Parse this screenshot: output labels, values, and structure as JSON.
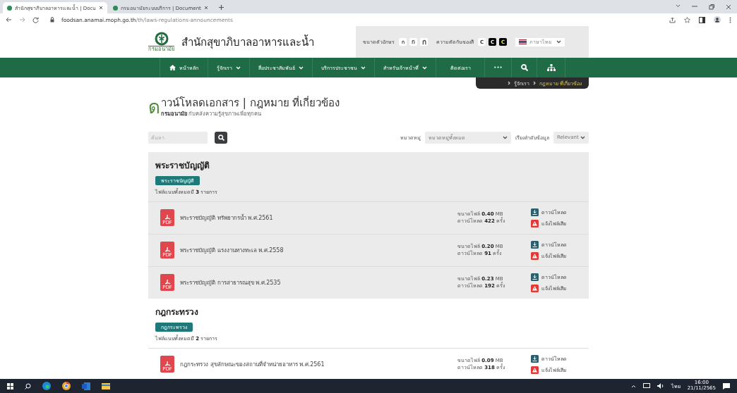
{
  "browser": {
    "tabs": [
      {
        "title": "สำนักสุขาภิบาลอาหารและน้ำ | Docu",
        "selected": true
      },
      {
        "title": "กรมอนามัยระบบบริการ | Document",
        "selected": false
      }
    ],
    "url_host": "foodsan.anamai.moph.go.th",
    "url_path": "/th/laws-regulations-announcements"
  },
  "header": {
    "site_name": "สำนักสุขาภิบาลอาหารและน้ำ",
    "logo_caption": "กรมอนามัย",
    "font_size_label": "ขนาดตัวอักษร",
    "font_sizes": [
      {
        "label": "ก",
        "kind": "small"
      },
      {
        "label": "ก",
        "kind": "medium"
      },
      {
        "label": "ก",
        "kind": "large"
      }
    ],
    "contrast_label": "ความตัดกันของสี",
    "contrast_options": [
      {
        "label": "C",
        "kind": "normal"
      },
      {
        "label": "C",
        "kind": "black"
      },
      {
        "label": "C",
        "kind": "yellow"
      }
    ],
    "language": "ภาษาไทย"
  },
  "nav": {
    "items": [
      {
        "label": "หน้าหลัก",
        "kind": "home"
      },
      {
        "label": "รู้จักเรา",
        "kind": "dropdown"
      },
      {
        "label": "สื่อประชาสัมพันธ์",
        "kind": "dropdown"
      },
      {
        "label": "บริการประชาชน",
        "kind": "dropdown"
      },
      {
        "label": "สำหรับเจ้าหน้าที่",
        "kind": "dropdown"
      },
      {
        "label": "ติดต่อเรา",
        "kind": "plain"
      },
      {
        "label": "•••",
        "kind": "plain"
      },
      {
        "kind": "search"
      },
      {
        "kind": "sitemap"
      }
    ]
  },
  "breadcrumb": [
    {
      "label": "รู้จักเรา",
      "current": false
    },
    {
      "label": "กฎหมาย ที่เกี่ยวข้อง",
      "current": true
    }
  ],
  "page": {
    "logo_letter": "ด",
    "title": "าวน์โหลดเอกสาร | กฎหมาย ที่เกี่ยวข้อง",
    "subtitle": "**กรมอนามัย** กับคลังความรู้สุขภาพเพื่อทุกคน"
  },
  "filters": {
    "search_placeholder": "ค้นหา",
    "category_label": "หมวดหมู่",
    "category_value": "หมวดหมู่ทั้งหมด",
    "sort_label": "เรียงลำดับข้อมูล",
    "sort_value": "Relevant"
  },
  "sections": [
    {
      "title": "พระราชบัญญัติ",
      "tag": "พระราชบัญญัติ",
      "count": "ไฟล์แนบทั้งหมดมี **3** รายการ",
      "highlighted": true,
      "files": [
        {
          "name": "พระราชบัญญัติ ทรัพยากรน้ำ พ.ศ.2561",
          "icon_text": "PDF",
          "size": "ขนาดไฟล์ **0.40** MB",
          "downloads": "ดาวน์โหลด **422** ครั้ง",
          "download_label": "ดาวน์โหลด",
          "report_label": "แจ้งไฟล์เสีย"
        },
        {
          "name": "พระราชบัญญัติ แรงงานทางทะเล พ.ศ.2558",
          "icon_text": "PDF",
          "size": "ขนาดไฟล์ **0.20** MB",
          "downloads": "ดาวน์โหลด **91** ครั้ง",
          "download_label": "ดาวน์โหลด",
          "report_label": "แจ้งไฟล์เสีย"
        },
        {
          "name": "พระราชบัญญัติ การสาธารณสุข พ.ศ.2535",
          "icon_text": "PDF",
          "size": "ขนาดไฟล์ **0.23** MB",
          "downloads": "ดาวน์โหลด **192** ครั้ง",
          "download_label": "ดาวน์โหลด",
          "report_label": "แจ้งไฟล์เสีย"
        }
      ]
    },
    {
      "title": "กฎกระทรวง",
      "tag": "กฎกระทรวง",
      "count": "ไฟล์แนบทั้งหมดมี **2** รายการ",
      "highlighted": false,
      "files": [
        {
          "name": "กฎกระทรวง สุขลักษณะของสถานที่จำหน่ายอาหาร พ.ศ.2561",
          "icon_text": "PDF",
          "size": "ขนาดไฟล์ **0.09** MB",
          "downloads": "ดาวน์โหลด **318** ครั้ง",
          "download_label": "ดาวน์โหลด",
          "report_label": "แจ้งไฟล์เสีย"
        }
      ]
    }
  ],
  "taskbar": {
    "language": "ไทย",
    "time": "16:00",
    "date": "21/11/2565"
  }
}
